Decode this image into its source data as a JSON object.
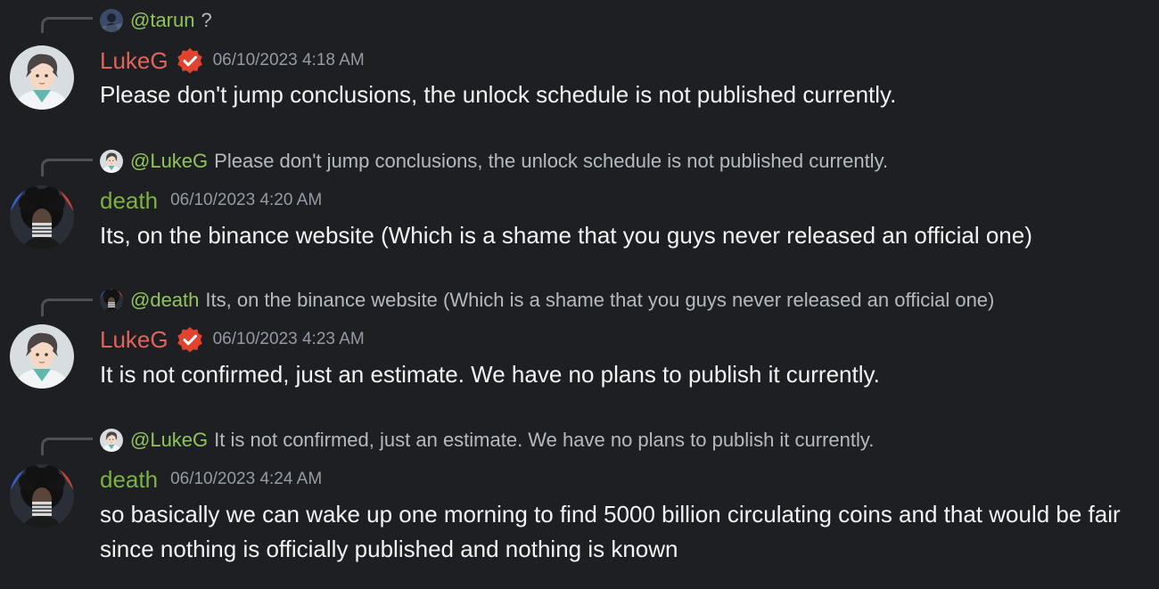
{
  "colors": {
    "background": "#1e1f22",
    "lukeg_name": "#e0635c",
    "death_name": "#7bb241",
    "mention": "#8fc55a",
    "verified_badge": "#e2432f"
  },
  "messages": [
    {
      "reply": {
        "mention": "@tarun",
        "text": "?"
      },
      "author": "LukeG",
      "verified": true,
      "timestamp": "06/10/2023 4:18 AM",
      "content": "Please don't jump conclusions, the unlock schedule is not published currently."
    },
    {
      "reply": {
        "mention": "@LukeG",
        "text": "Please don't jump conclusions, the unlock schedule is not published currently."
      },
      "author": "death",
      "verified": false,
      "timestamp": "06/10/2023 4:20 AM",
      "content": "Its, on the binance website (Which is a shame that you guys never released an official one)"
    },
    {
      "reply": {
        "mention": "@death",
        "text": "Its, on the binance website (Which is a shame that you guys never released an official one)"
      },
      "author": "LukeG",
      "verified": true,
      "timestamp": "06/10/2023 4:23 AM",
      "content": "It is not confirmed, just an estimate. We have no plans to publish it currently."
    },
    {
      "reply": {
        "mention": "@LukeG",
        "text": "It is not confirmed, just an estimate. We have no plans to publish it currently."
      },
      "author": "death",
      "verified": false,
      "timestamp": "06/10/2023 4:24 AM",
      "content": "so basically we can wake up one morning to find 5000 billion circulating coins and that would be fair since nothing is officially published and nothing is known"
    }
  ]
}
